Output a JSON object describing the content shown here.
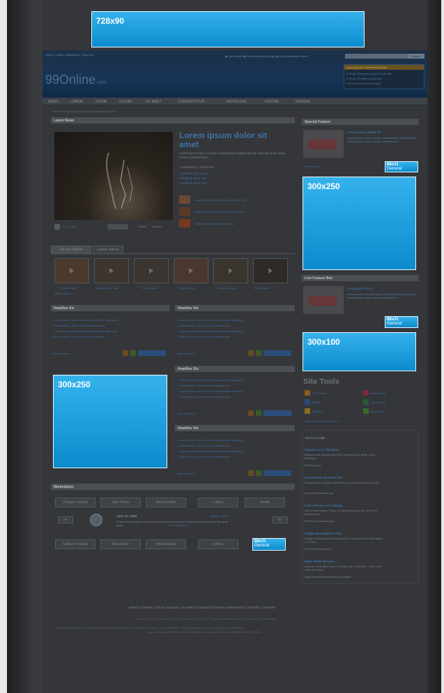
{
  "top_ad": {
    "label": "728x90"
  },
  "header": {
    "util_links": "Sign In | Gifts & Newsletters | Read On",
    "logo_main": "99Online",
    "logo_suffix": ".com",
    "search_options": "◉ Our Search  ◉ Web Search by Google  ◉ Local Business Search",
    "search_button": "Search",
    "upcoming": {
      "title": "Upcoming Live Streaming Events",
      "items": [
        "6:00 pm   Recreation Sport Event Title",
        "6:30 pm   Proident Curriculum",
        "9:00 pm   Event at the Venue"
      ]
    }
  },
  "nav": {
    "items": [
      "NEWS",
      "LOREM",
      "IPSUM",
      "DOLOR",
      "SIT AMET",
      "CONSECTETUR",
      "ADIPISCING",
      "TORTOR",
      "VIVERRA"
    ]
  },
  "breadcrumb": "Home > Local > Some in Here Somewhere Here 99",
  "latest_news": {
    "bar": "Latest News",
    "headline": "Lorem ipsum dolor sit amet",
    "summary": "Lorem ipsum dolor sit amet, consectetuer adipiscing elit. Sed faucibus, tortor viverra condimentum.",
    "comments": "Comments ( 1 )  Rate this",
    "related": [
      "• Related Video Story",
      "• Related Story One",
      "• Related Story Two"
    ],
    "side_items": [
      "Lorem ipsum dolor sit amet, consect. 1:00",
      "Adipiscing elit, sed faucibus tortor viverra",
      "Trials to what forms learn, ensue"
    ],
    "controls": {
      "prev": "Prev | Next",
      "pages": "1 | 2 | 3",
      "pause": "Pause",
      "expand": "Expand"
    }
  },
  "videos": {
    "tabs": [
      "Popular Videos",
      "Latest Videos"
    ],
    "captions": [
      "Motor Boats",
      "Nuggets Lost Take",
      "Trials Growth",
      "Realty Class",
      "Surgery Lesson",
      "Motor Boats",
      "More Videos »"
    ]
  },
  "headline_left": {
    "bar": "Headline Six",
    "items": [
      "• Lorem ipsum dolor sit amet consectetuer adipiscing",
      "• Sed faucibus, tortor viverra condimentum",
      "• Lorem ipsum dolor sit amet consectetuer adipiscing",
      "• Sed faucibus, tortor viverra condimentum"
    ],
    "more": "More Stories »"
  },
  "headline_right": [
    {
      "bar": "Headline Six",
      "items": [
        "• Lorem ipsum dolor sit amet consectetuer adipiscing",
        "• Sed faucibus, tortor viverra condimentum",
        "• Lorem ipsum dolor sit amet consectetuer adipiscing",
        "• Sed faucibus, tortor viverra condimentum"
      ],
      "more": "More Stories »"
    },
    {
      "bar": "Headline Six",
      "items": [
        "• Lorem ipsum dolor sit amet consectetuer adipiscing",
        "• Sed faucibus, tortor viverra condimentum",
        "• Lorem ipsum dolor sit amet consectetuer adipiscing",
        "• Sed faucibus, tortor viverra condimentum"
      ],
      "more": "More Stories »"
    },
    {
      "bar": "Headline Six",
      "items": [
        "• Lorem ipsum dolor sit amet consectetuer adipiscing",
        "• Sed faucibus, tortor viverra condimentum",
        "• Lorem ipsum dolor sit amet consectetuer adipiscing",
        "• Sed faucibus, tortor viverra condimentum"
      ],
      "more": "More Stories »"
    }
  ],
  "ad_300x250_left": {
    "label": "300x250"
  },
  "ad_300x250_right": {
    "label": "300x250"
  },
  "ad_300x100": {
    "label": "300x100"
  },
  "ad_88x31": {
    "line1": "88x31",
    "line2": "General"
  },
  "special_feature": {
    "bar": "Special Feature",
    "title": "Lorem Ipsum Dolor Sit",
    "text": "Lorem ipsum dolor sit amet, consectetuer adipiscing elit. Sed faucibus, tortor viverra condimentum.",
    "more": "More Stories »"
  },
  "live_feature": {
    "bar": "Live Feature Box",
    "title": "MortgageFinders.tv",
    "text": "Lorem ipsum dolor sit amet, consectetuer adipiscing elit. Sed faucibus, tortor viverra condimentum."
  },
  "site_tools": {
    "title": "Site Tools",
    "items": [
      "RSS Feeds",
      "Email Alerts",
      "Mobile",
      "Newsletters",
      "Widgets",
      "Text Alerts"
    ],
    "link": "Make 99 Your Home Page »"
  },
  "ads_by_google": {
    "title": "Ads by Google",
    "ads": [
      {
        "h": "Prepare to be Shocked",
        "t": "Millions have already seen this amazing and. What's your Reading?",
        "u": "Reading.com"
      },
      {
        "h": "10 Rules for Stomach Fat",
        "t": "Follow these 10 Easy Diet Rules & Lose 9 lbs every 11 Days",
        "u": "www.FatLossIdiots.com"
      },
      {
        "h": "Find a Person in 1 Minute",
        "t": "Get Current Name, Phone & Address for Anyone. Get Free Results Now",
        "u": "Public-records-now.com"
      },
      {
        "h": "Single Mom Makes $ Gig",
        "t": "Really Lost Home to Coming News in 4 Week Than Most Make in a Year",
        "u": "97Jobs/Financial.com"
      },
      {
        "h": "Make Dollar Mission",
        "t": "Discover How Bed Does it. Works only! 25 Minute. Learn How Here and Read",
        "u": "www.OnlineWealthMachines.com/site"
      }
    ]
  },
  "marketplace": {
    "bar": "Marketplace",
    "row1": [
      "College Counsel",
      "Auto Show",
      "Merchandise",
      "Lottery",
      "Health"
    ],
    "row2": [
      "College Counsel",
      "Auto Show",
      "Merchandise",
      "Lottery"
    ],
    "event_date": "June 17, 2005",
    "event_links": "Website | More",
    "event_text": "A brand new & great movie that amazing out results you help with the planning of the great party.",
    "event_link2": "Full Disclaimer »",
    "prev": "◄",
    "next": "►"
  },
  "footer": {
    "nav": "NEWS | LOREM | IPSUM | DOLOR | SIT AMET | CONSECTETUER | ADIPISCING | TORTOR | VIVERRA",
    "links": "Terms of Service | Privacy Policy | Contact Us | Jobs | FCC Filings | Advertise with Us | Contact Us | 99 Interactive",
    "legal1": "Lorem ipsum dolor sit amet, consectetuer adipiscing elit. Sed in augue. Cras faucibus. Praesent, luctus blandit felis. Phasellus non ante dictum a blandit felis condimentum nunc.",
    "legal2": "Turpis, Rhoncus ac bibendum, velit a congue dictum, Nam lacus, and ipsum. All Rights Reserved © 2009."
  }
}
